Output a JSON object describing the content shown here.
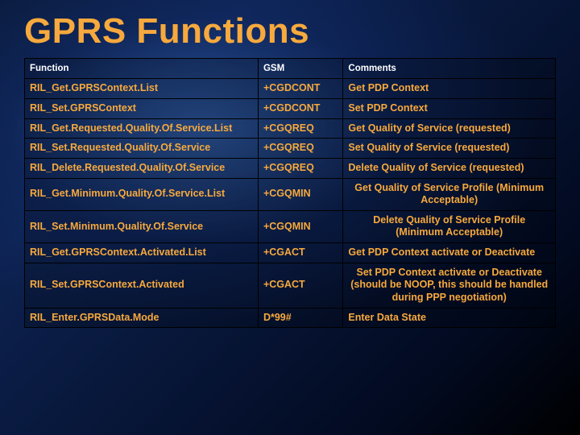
{
  "title": "GPRS Functions",
  "table": {
    "headers": [
      "Function",
      "GSM",
      "Comments"
    ],
    "rows": [
      {
        "func": "RIL_Get.GPRSContext.List",
        "gsm": "+CGDCONT",
        "comment": "Get PDP Context",
        "align": "left"
      },
      {
        "func": "RIL_Set.GPRSContext",
        "gsm": "+CGDCONT",
        "comment": "Set PDP Context",
        "align": "left"
      },
      {
        "func": "RIL_Get.Requested.Quality.Of.Service.List",
        "gsm": "+CGQREQ",
        "comment": "Get Quality of Service (requested)",
        "align": "left"
      },
      {
        "func": "RIL_Set.Requested.Quality.Of.Service",
        "gsm": "+CGQREQ",
        "comment": "Set Quality of Service (requested)",
        "align": "left"
      },
      {
        "func": "RIL_Delete.Requested.Quality.Of.Service",
        "gsm": "+CGQREQ",
        "comment": "Delete Quality of Service (requested)",
        "align": "left"
      },
      {
        "func": "RIL_Get.Minimum.Quality.Of.Service.List",
        "gsm": "+CGQMIN",
        "comment": "Get Quality of Service Profile (Minimum Acceptable)",
        "align": "center"
      },
      {
        "func": "RIL_Set.Minimum.Quality.Of.Service",
        "gsm": "+CGQMIN",
        "comment": "Delete Quality of Service Profile (Minimum Acceptable)",
        "align": "center"
      },
      {
        "func": "RIL_Get.GPRSContext.Activated.List",
        "gsm": "+CGACT",
        "comment": "Get PDP Context activate or Deactivate",
        "align": "left"
      },
      {
        "func": "RIL_Set.GPRSContext.Activated",
        "gsm": "+CGACT",
        "comment": "Set PDP Context activate or Deactivate (should be NOOP, this should be handled during PPP negotiation)",
        "align": "center"
      },
      {
        "func": "RIL_Enter.GPRSData.Mode",
        "gsm": "D*99#",
        "comment": "Enter Data State",
        "align": "left"
      }
    ]
  }
}
